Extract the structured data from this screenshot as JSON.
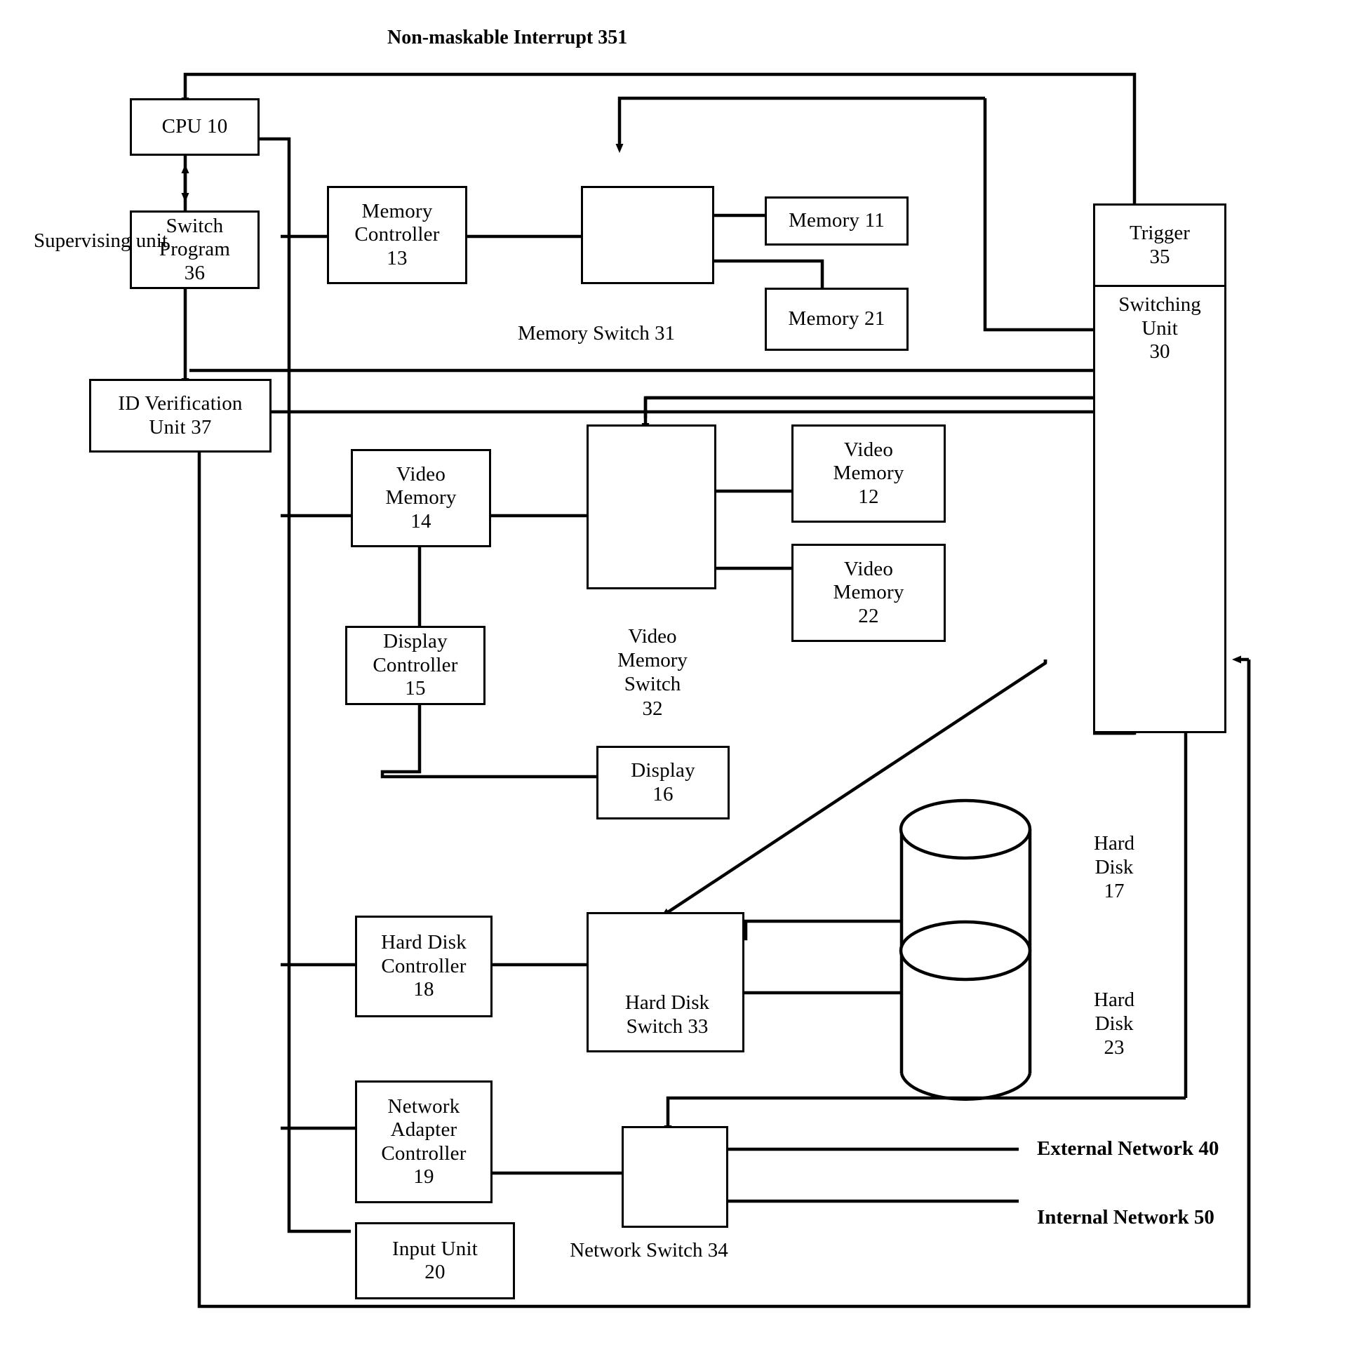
{
  "figure": {
    "title_note": "Non-maskable Interrupt 351",
    "supervising_label": "Supervising unit"
  },
  "nodes": {
    "cpu": "CPU 10",
    "switch_program": "Switch\nProgram\n36",
    "id_verification": "ID Verification\nUnit 37",
    "memory_controller": "Memory\nController\n13",
    "memory_11": "Memory 11",
    "memory_21": "Memory 21",
    "video_memory_14": "Video\nMemory\n14",
    "video_memory_12": "Video\nMemory\n12",
    "video_memory_22": "Video\nMemory\n22",
    "display_controller": "Display\nController\n15",
    "display_16": "Display\n16",
    "hard_disk_controller": "Hard Disk\nController\n18",
    "network_adapter_controller": "Network\nAdapter\nController\n19",
    "input_unit": "Input Unit\n20",
    "trigger": "Trigger\n35",
    "switching_unit": "Switching\nUnit\n30"
  },
  "captions": {
    "memory_switch": "Memory Switch 31",
    "video_memory_switch": "Video\nMemory\nSwitch\n32",
    "hard_disk_switch": "Hard Disk\nSwitch 33",
    "network_switch": "Network Switch 34",
    "hard_disk_17": "Hard\nDisk\n17",
    "hard_disk_23": "Hard\nDisk\n23",
    "external_network": "External Network 40",
    "internal_network": "Internal Network 50"
  },
  "colors": {
    "line": "#000000",
    "background": "#ffffff"
  }
}
